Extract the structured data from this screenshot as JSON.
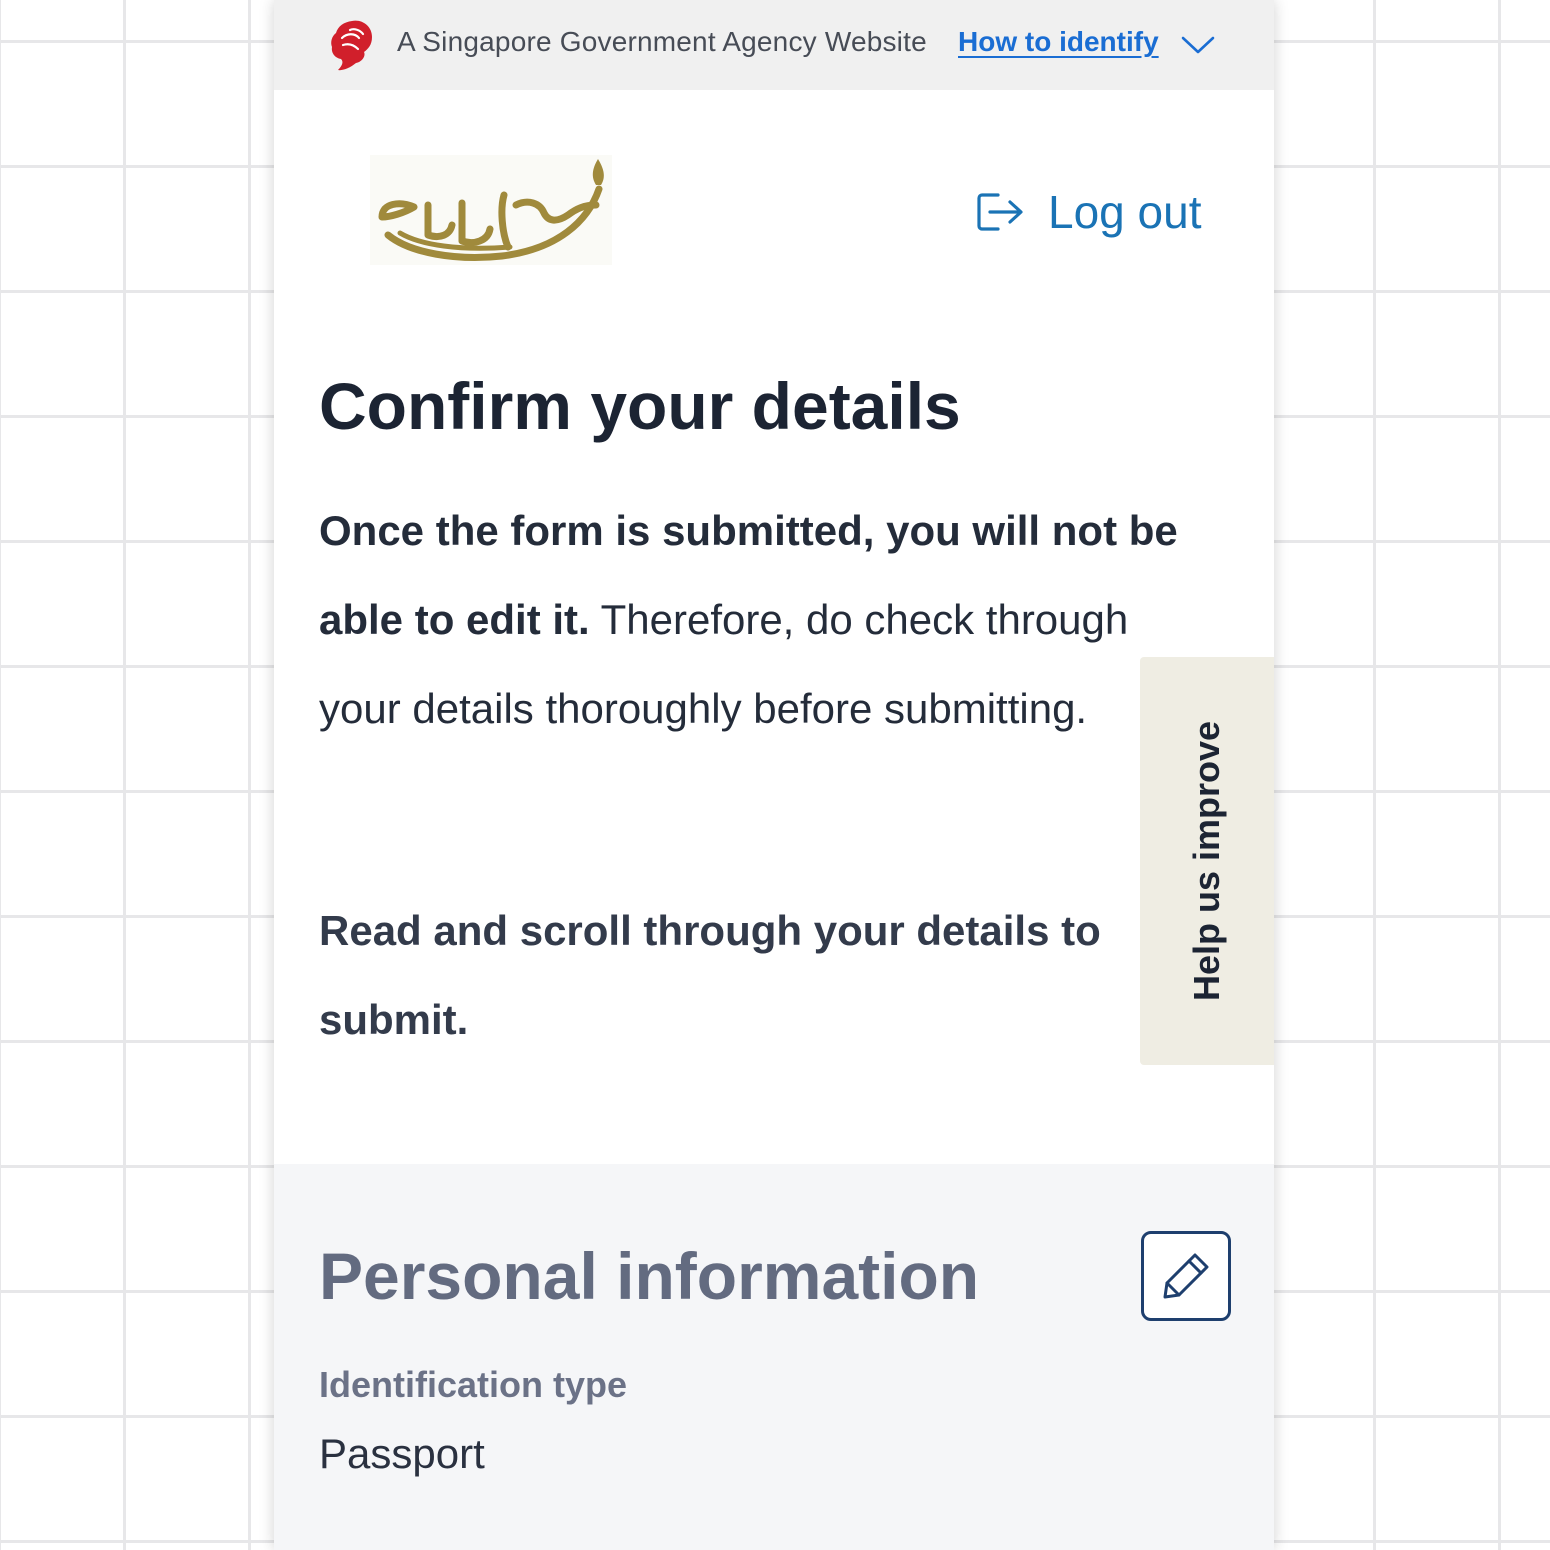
{
  "gov_banner": {
    "text": "A Singapore Government Agency Website",
    "link": "How to identify",
    "icon": "lion-head-icon",
    "toggle_icon": "chevron-down-icon"
  },
  "header": {
    "logo": "agency-lamp-logo",
    "logout_label": "Log out",
    "logout_icon": "logout-icon"
  },
  "page": {
    "title": "Confirm your details",
    "intro_bold": "Once the form is submitted, you will not be able to edit it.",
    "intro_rest": " Therefore, do check through your details thoroughly before submitting.",
    "instruction": "Read and scroll through your details to submit."
  },
  "feedback_tab": {
    "label": "Help us improve"
  },
  "section": {
    "title": "Personal information",
    "edit_icon": "pencil-icon",
    "fields": [
      {
        "label": "Identification type",
        "value": "Passport"
      }
    ]
  },
  "colors": {
    "link_blue": "#1a6dd3",
    "logout_blue": "#1a73b5",
    "lion_red": "#d11f2b",
    "logo_gold": "#a08a3c",
    "feedback_tab_bg": "#efede3",
    "section_bg": "#f5f6f8",
    "heading_dark": "#1c2433"
  }
}
